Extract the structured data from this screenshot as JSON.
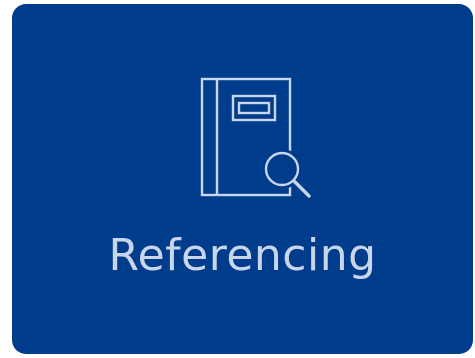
{
  "tile": {
    "label": "Referencing",
    "icon": "book-search-icon",
    "background_color": "#003c8c",
    "foreground_color": "#c9d6ea"
  }
}
